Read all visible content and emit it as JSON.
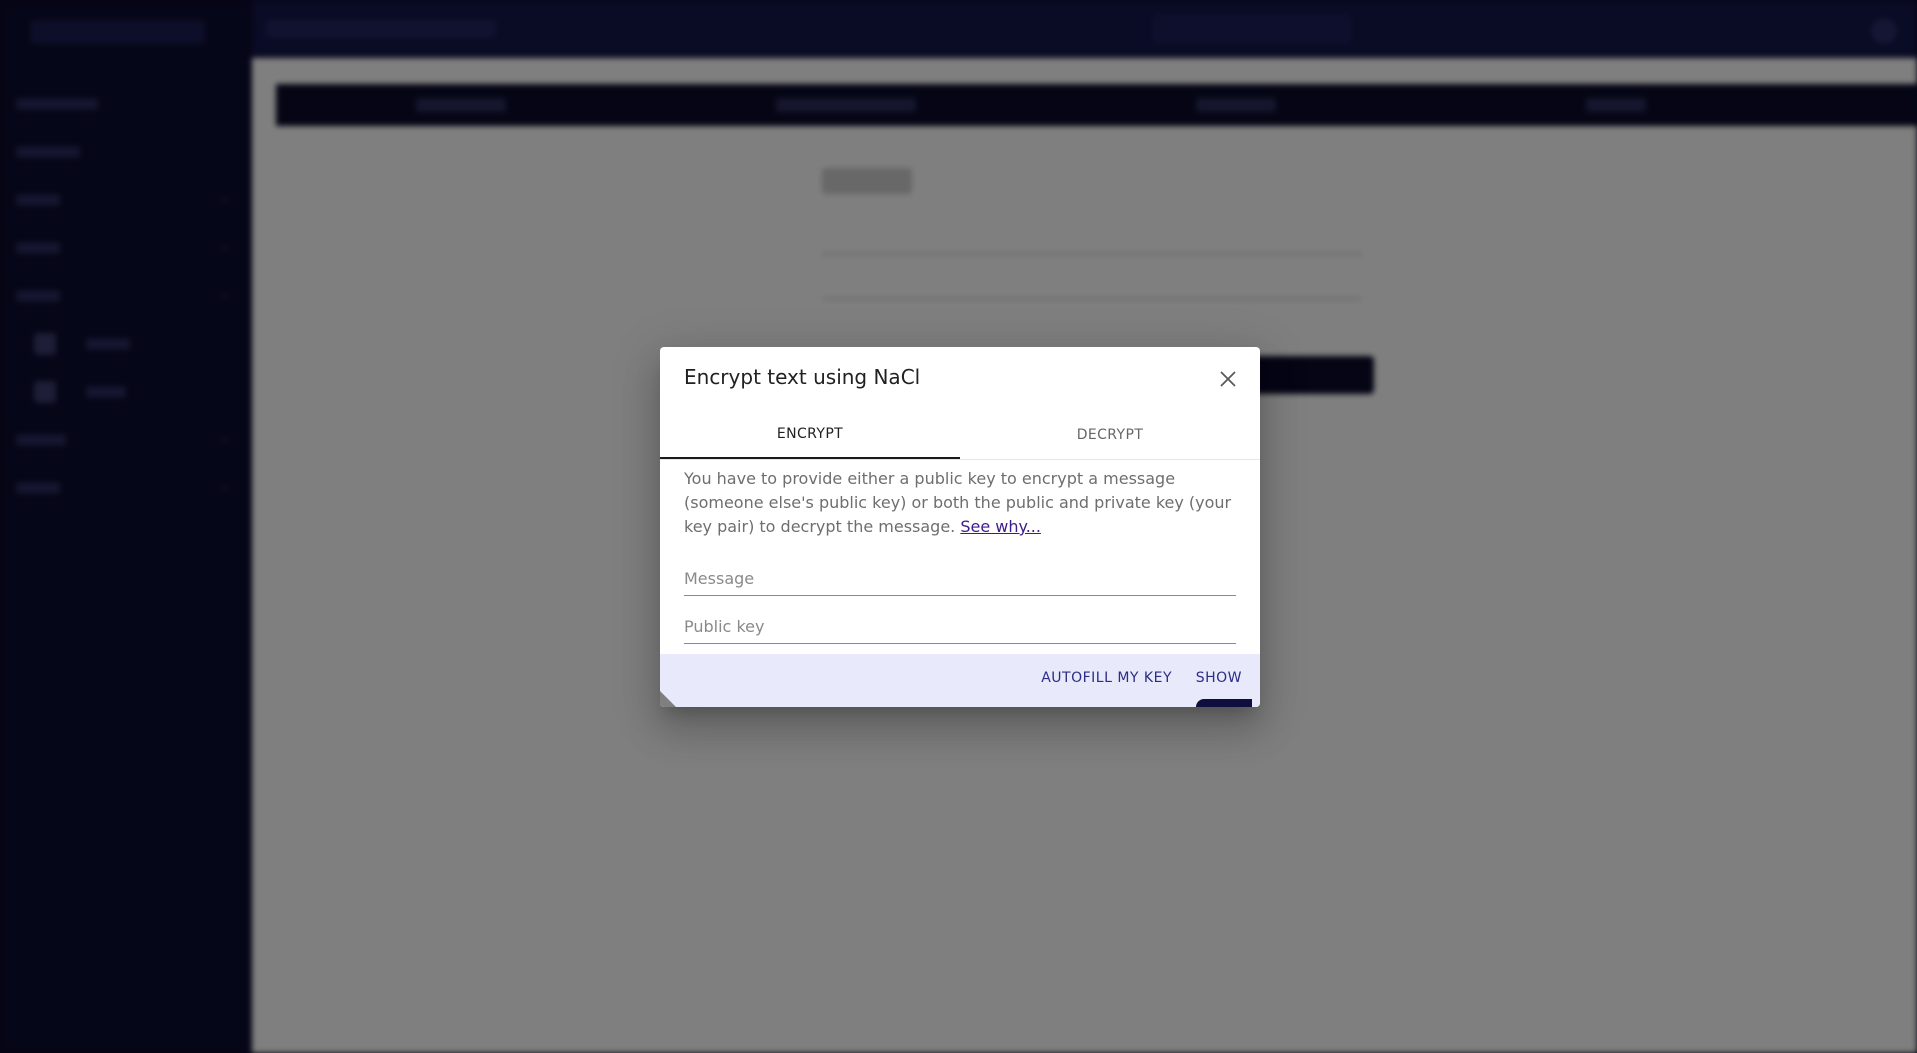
{
  "dialog": {
    "title": "Encrypt text using NaCl",
    "tabs": [
      {
        "label": "ENCRYPT",
        "active": true
      },
      {
        "label": "DECRYPT",
        "active": false
      }
    ],
    "description": "You have to provide either a public key to encrypt a message (someone else's public key) or both the public and private key (your key pair) to decrypt the message.",
    "see_why_link": "See why...",
    "message_placeholder": "Message",
    "public_key_placeholder": "Public key",
    "autofill_button": "AUTOFILL MY KEY",
    "show_button": "SHOW"
  },
  "colors": {
    "accent": "#2b2d83",
    "link": "#3c1b8c",
    "actions_bg": "#e8e9fb",
    "sidebar_bg": "#0b0c2e"
  }
}
